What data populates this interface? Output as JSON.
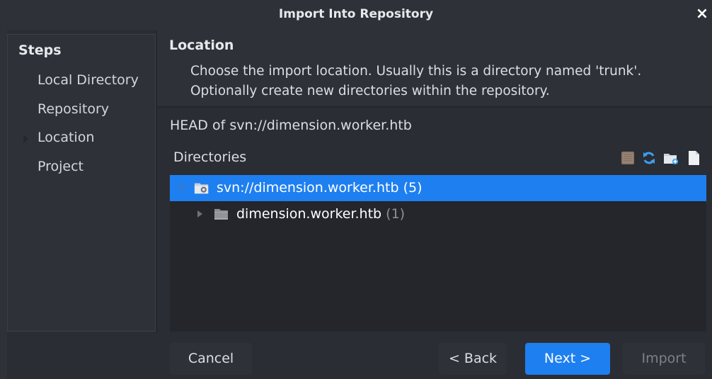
{
  "window": {
    "title": "Import Into Repository",
    "close_glyph": "×"
  },
  "steps": {
    "title": "Steps",
    "items": [
      {
        "label": "Local Directory",
        "current": false
      },
      {
        "label": "Repository",
        "current": false
      },
      {
        "label": "Location",
        "current": true
      },
      {
        "label": "Project",
        "current": false
      }
    ]
  },
  "header": {
    "title": "Location",
    "description_line1": "Choose the import location. Usually this is a directory named 'trunk'.",
    "description_line2": "Optionally create new directories within the repository."
  },
  "location": {
    "head_label": "HEAD of svn://dimension.worker.htb",
    "directories_label": "Directories",
    "toolbar_icons": [
      "stop-icon",
      "refresh-icon",
      "new-folder-icon",
      "file-icon"
    ]
  },
  "tree": {
    "rows": [
      {
        "label": "svn://dimension.worker.htb",
        "count": "(5)",
        "expanded": true,
        "selected": true,
        "icon": "repository-folder-icon"
      },
      {
        "label": "dimension.worker.htb",
        "count": "(1)",
        "expanded": false,
        "selected": false,
        "icon": "folder-icon"
      }
    ]
  },
  "buttons": {
    "cancel": "Cancel",
    "back": "< Back",
    "next": "Next >",
    "import": "Import"
  },
  "colors": {
    "accent": "#1e7ff0",
    "background": "#2b2d34",
    "panel": "#2f3139",
    "tree_background": "#24262c"
  }
}
